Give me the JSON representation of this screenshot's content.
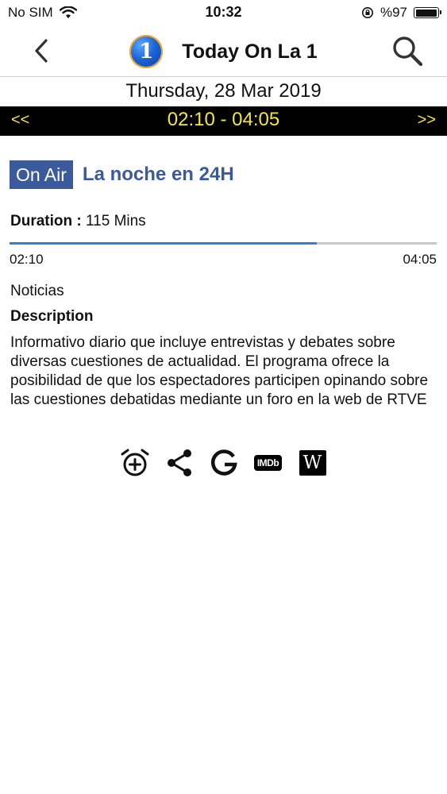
{
  "status_bar": {
    "carrier": "No SIM",
    "time": "10:32",
    "battery": "%97",
    "icons": [
      "wifi-icon",
      "rotation-lock-icon",
      "battery-icon"
    ]
  },
  "nav": {
    "title": "Today On La 1",
    "channel_logo_text": "1",
    "icons": [
      "back-chevron-icon",
      "search-icon"
    ]
  },
  "schedule": {
    "date": "Thursday, 28 Mar 2019",
    "prev_label": "<<",
    "time_range": "02:10 - 04:05",
    "next_label": ">>"
  },
  "program": {
    "on_air_label": "On Air",
    "title": "La noche en 24H",
    "duration_label": "Duration :",
    "duration_value": "115 Mins",
    "start_time": "02:10",
    "end_time": "04:05",
    "progress_fraction": 0.72,
    "genre": "Noticias",
    "description_heading": "Description",
    "description": "Informativo diario que incluye entrevistas y debates sobre diversas cuestiones de actualidad. El programa ofrece la posibilidad de que los espectadores participen opinando sobre las cuestiones debatidas mediante un foro en la web de RTVE"
  },
  "actions": {
    "icons": [
      "alarm-add-icon",
      "share-icon",
      "google-icon",
      "imdb-icon",
      "wikipedia-icon"
    ],
    "imdb_text": "IMDb",
    "wiki_text": "W"
  },
  "colors": {
    "accent_blue": "#3a5a9b",
    "time_bar_bg": "#000000",
    "time_bar_text": "#f4e63c",
    "progress_fill": "#2f7fd6"
  }
}
